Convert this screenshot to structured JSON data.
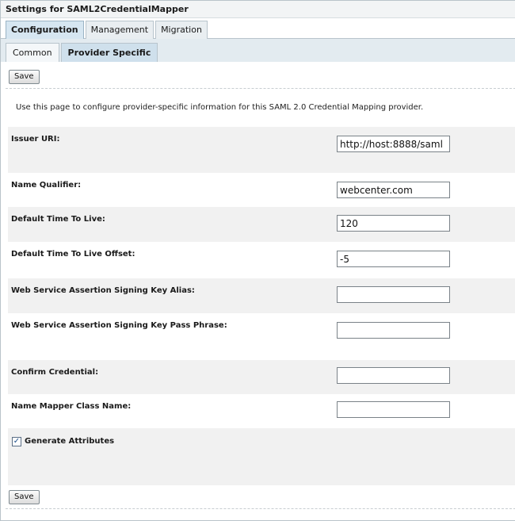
{
  "window": {
    "title": "Settings for SAML2CredentialMapper"
  },
  "tabs": [
    {
      "label": "Configuration"
    },
    {
      "label": "Management"
    },
    {
      "label": "Migration"
    }
  ],
  "subtabs": [
    {
      "label": "Common"
    },
    {
      "label": "Provider Specific"
    }
  ],
  "actions": {
    "save_label": "Save"
  },
  "description": "Use this page to configure provider-specific information for this SAML 2.0 Credential Mapping provider.",
  "fields": {
    "issuer_uri": {
      "label": "Issuer URI:",
      "value": "http://host:8888/saml"
    },
    "name_qualifier": {
      "label": "Name Qualifier:",
      "value": "webcenter.com"
    },
    "default_ttl": {
      "label": "Default Time To Live:",
      "value": "120"
    },
    "default_ttl_offset": {
      "label": "Default Time To Live Offset:",
      "value": "-5"
    },
    "ws_signing_key_alias": {
      "label": "Web Service Assertion Signing Key Alias:",
      "value": ""
    },
    "ws_signing_key_pass": {
      "label": "Web Service Assertion Signing Key Pass Phrase:",
      "value": ""
    },
    "confirm_credential": {
      "label": "Confirm Credential:",
      "value": ""
    },
    "name_mapper_class": {
      "label": "Name Mapper Class Name:",
      "value": ""
    }
  },
  "generate_attributes": {
    "label": "Generate Attributes",
    "checked": true
  }
}
